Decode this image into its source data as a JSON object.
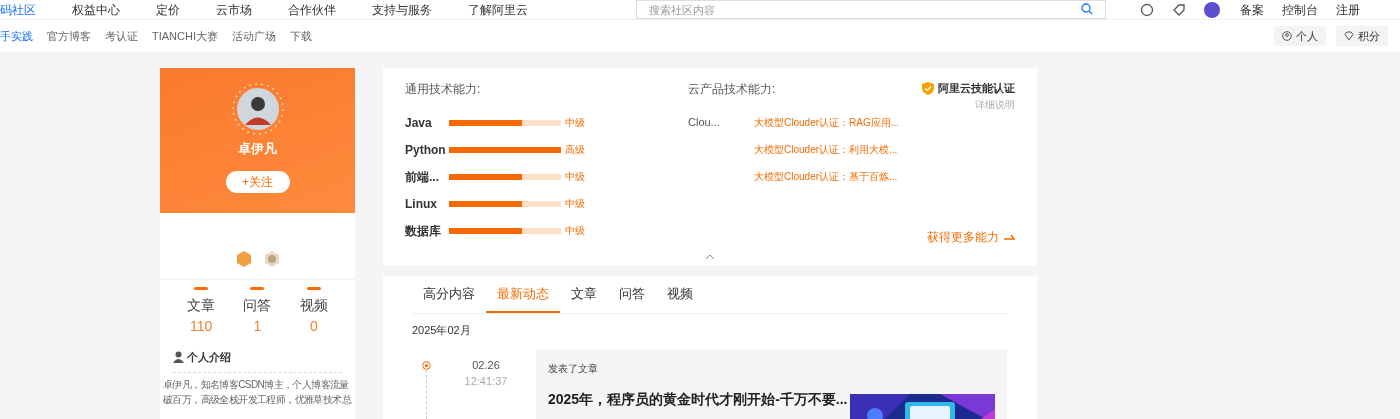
{
  "top_nav": {
    "items": [
      "码社区",
      "权益中心",
      "定价",
      "云市场",
      "合作伙伴",
      "支持与服务",
      "了解阿里云"
    ],
    "search": {
      "placeholder": "搜索社区内容"
    },
    "links": [
      "备案",
      "控制台",
      "注册"
    ]
  },
  "sub_nav": {
    "items": [
      {
        "label": "手实践",
        "selected": true
      },
      {
        "label": "官方博客",
        "selected": false
      },
      {
        "label": "考认证",
        "selected": false
      },
      {
        "label": "TIANCHI大赛",
        "selected": false
      },
      {
        "label": "活动广场",
        "selected": false
      },
      {
        "label": "下载",
        "selected": false
      }
    ],
    "buttons": [
      "个人",
      "积分"
    ]
  },
  "profile": {
    "name": "卓伊凡",
    "follow": "+关注",
    "stats": [
      {
        "label": "文章",
        "value": "110"
      },
      {
        "label": "问答",
        "value": "1"
      },
      {
        "label": "视频",
        "value": "0"
      }
    ],
    "intro_title": "个人介绍",
    "intro": "卓伊凡，知名博客CSDN博主，个人博客流量破百万，高级全栈开发工程师，优雅草技术总"
  },
  "skills": {
    "general_title": "通用技术能力:",
    "general": [
      {
        "name": "Java",
        "level": 0.65,
        "grade": "中级"
      },
      {
        "name": "Python",
        "level": 1,
        "grade": "高级"
      },
      {
        "name": "前端...",
        "level": 0.65,
        "grade": "中级"
      },
      {
        "name": "Linux",
        "level": 0.65,
        "grade": "中级"
      },
      {
        "name": "数据库",
        "level": 0.65,
        "grade": "中级"
      }
    ],
    "cloud_title": "云产品技术能力:",
    "cloud_label": "Clou...",
    "certs": [
      "大模型Clouder认证：RAG应用...",
      "大模型Clouder认证：利用大模...",
      "大模型Clouder认证：基于百炼..."
    ],
    "badge": "阿里云技能认证",
    "badge_detail": "详细说明",
    "more": "获得更多能力"
  },
  "feed": {
    "tabs": [
      {
        "label": "高分内容",
        "selected": false
      },
      {
        "label": "最新动态",
        "selected": true
      },
      {
        "label": "文章",
        "selected": false
      },
      {
        "label": "问答",
        "selected": false
      },
      {
        "label": "视频",
        "selected": false
      }
    ],
    "month": "2025年02月",
    "entries": [
      {
        "date": "02.26",
        "time": "12:41:37",
        "action": "发表了文章",
        "title": "2025年，程序员的黄金时代才刚开始-千万不要..."
      }
    ]
  }
}
